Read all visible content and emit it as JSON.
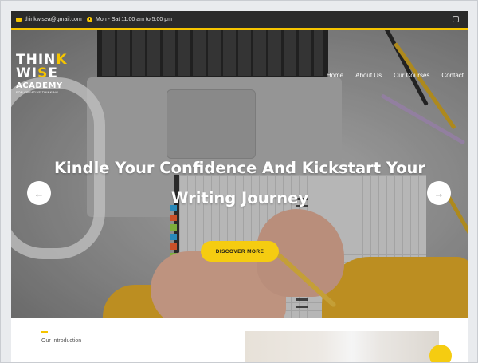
{
  "topbar": {
    "email": "thinkwisea@gmail.com",
    "hours": "Mon - Sat 11:00 am to 5:00 pm"
  },
  "logo": {
    "line1_a": "THIN",
    "line1_b": "K",
    "line2_a": "WI",
    "line2_b": "S",
    "line2_c": "E",
    "line3": "ACADEMY",
    "tagline": "FOR CREATIVE THINKING"
  },
  "nav": {
    "items": [
      "Home",
      "About Us",
      "Our Courses",
      "Contact"
    ]
  },
  "hero": {
    "headline_line1": "Kindle Your Confidence And Kickstart Your",
    "headline_line2": "Writing Journey",
    "cta_label": "DISCOVER MORE",
    "prev_arrow": "←",
    "next_arrow": "→"
  },
  "intro": {
    "label": "Our Introduction"
  },
  "colors": {
    "accent": "#f5c400",
    "topbar_bg": "#2a2a2a",
    "cta_bg": "#f5cc11"
  }
}
